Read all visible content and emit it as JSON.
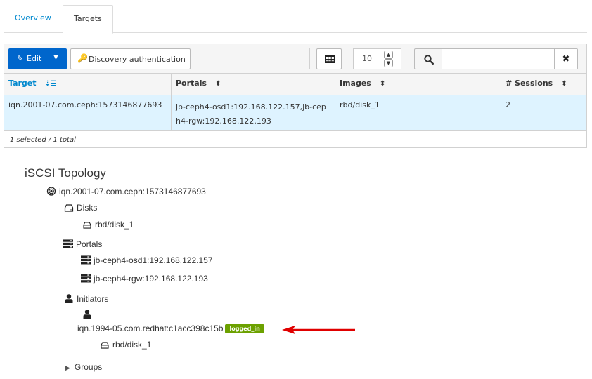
{
  "tabs": [
    {
      "label": "Overview",
      "active": false
    },
    {
      "label": "Targets",
      "active": true
    }
  ],
  "toolbar": {
    "edit_label": "Edit",
    "discovery_label": "Discovery authentication",
    "page_size": "10",
    "search_value": "",
    "search_placeholder": ""
  },
  "table": {
    "columns": [
      {
        "label": "Target",
        "sorted": true
      },
      {
        "label": "Portals",
        "sorted": false
      },
      {
        "label": "Images",
        "sorted": false
      },
      {
        "label": "# Sessions",
        "sorted": false
      }
    ],
    "rows": [
      {
        "target": "iqn.2001-07.com.ceph:1573146877693",
        "portals": "jb-ceph4-osd1:192.168.122.157,jb-ceph4-rgw:192.168.122.193",
        "images": "rbd/disk_1",
        "sessions": "2",
        "selected": true
      }
    ],
    "footer": "1 selected / 1 total"
  },
  "topology": {
    "title": "iSCSI Topology",
    "target": "iqn.2001-07.com.ceph:1573146877693",
    "disks_label": "Disks",
    "disks": [
      "rbd/disk_1"
    ],
    "portals_label": "Portals",
    "portals": [
      "jb-ceph4-osd1:192.168.122.157",
      "jb-ceph4-rgw:192.168.122.193"
    ],
    "initiators_label": "Initiators",
    "initiator": {
      "name": "iqn.1994-05.com.redhat:c1acc398c15b",
      "status": "logged_in",
      "disk": "rbd/disk_1"
    },
    "groups_label": "Groups"
  },
  "colors": {
    "primary": "#0066cc",
    "link": "#0088ce",
    "selected_row": "#def3ff",
    "badge_success": "#6ca100",
    "annotation_arrow": "#e00000"
  }
}
